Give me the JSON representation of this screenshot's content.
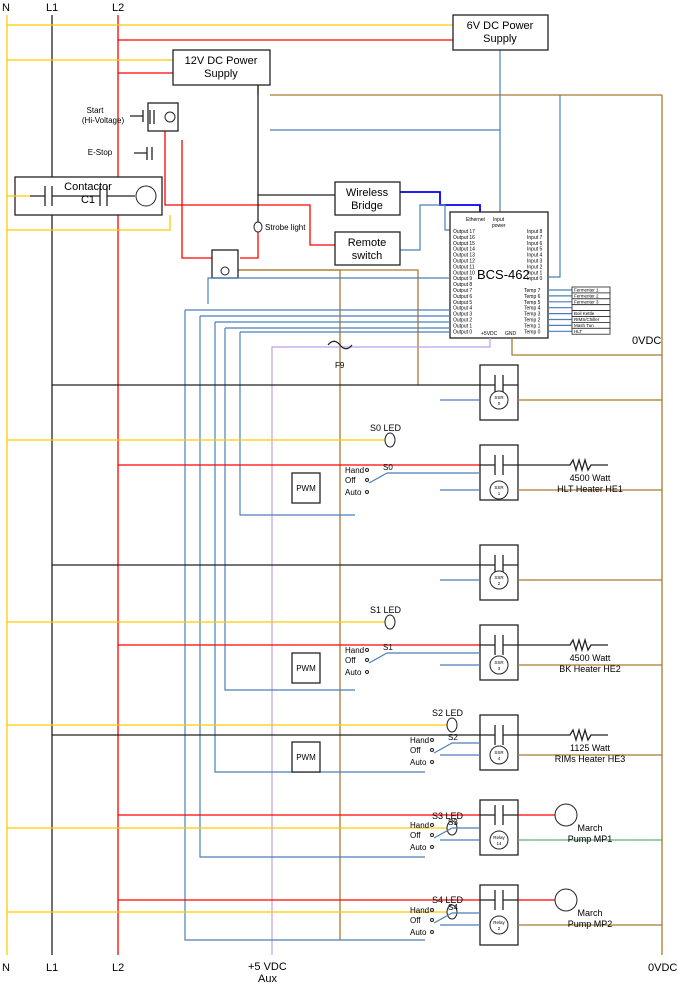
{
  "rails": {
    "neutral": "N",
    "line1": "L1",
    "line2": "L2",
    "zero_vdc": "0VDC",
    "aux": "+5 VDC",
    "aux2": "Aux"
  },
  "colors": {
    "neutral": "#ffcc00",
    "line1": "#222222",
    "line2": "#ff0000",
    "signal": "#4a7ebb",
    "dc_return": "#a87b2c",
    "aux_5v": "#b9a0ea"
  },
  "supplies": {
    "v6": [
      "6V DC Power",
      "Supply"
    ],
    "v12": [
      "12V DC Power",
      "Supply"
    ]
  },
  "controls": {
    "start": [
      "Start",
      "(Hi-Voltage)"
    ],
    "estop": "E-Stop",
    "contactor": [
      "Contactor",
      "C1"
    ],
    "strobe": "Strobe light",
    "fuse": "F9"
  },
  "network": {
    "wireless": [
      "Wireless",
      "Bridge"
    ],
    "remote": [
      "Remote",
      "switch"
    ]
  },
  "bcs": {
    "title": "BCS-462",
    "ethernet": "Ethernet",
    "input_power": [
      "Input",
      "power"
    ],
    "outputs": [
      "Output 17",
      "Output 16",
      "Output 15",
      "Output 14",
      "Output 13",
      "Output 12",
      "Output 11",
      "Output 10",
      "Output 9",
      "Output 8",
      "Output 7",
      "Output 6",
      "Output 5",
      "Output 4",
      "Output 3",
      "Output 2",
      "Output 1",
      "Output 0"
    ],
    "inputs": [
      "Input 8",
      "Input 7",
      "Input 6",
      "Input 5",
      "Input 4",
      "Input 3",
      "Input 2",
      "Input 1",
      "Input 0"
    ],
    "temps": [
      "Temp 7",
      "Temp 6",
      "Temp 5",
      "Temp 4",
      "Temp 3",
      "Temp 2",
      "Temp 1",
      "Temp 0"
    ],
    "temp_probes": [
      "Fermenter 1",
      "Fermenter 2",
      "Fermenter 3",
      "",
      "Boil Kettle",
      "RIMS/Chiller",
      "Mash Tun",
      "HLT"
    ],
    "v5": "+5VDC",
    "gnd": "GND"
  },
  "relays": [
    {
      "label": [
        "SSR",
        "0"
      ]
    },
    {
      "label": [
        "SSR",
        "1"
      ]
    },
    {
      "label": [
        "SSR",
        "2"
      ]
    },
    {
      "label": [
        "SSR",
        "3"
      ]
    },
    {
      "label": [
        "SSR",
        "4"
      ]
    },
    {
      "label": [
        "Relay",
        "14"
      ]
    },
    {
      "label": [
        "Relay",
        "2"
      ]
    }
  ],
  "leds": [
    "S0 LED",
    "S1 LED",
    "S2 LED",
    "S3 LED",
    "S4 LED"
  ],
  "switches": {
    "hand": "Hand",
    "off": "Off",
    "auto": "Auto",
    "names": [
      "S0",
      "S1",
      "S2",
      "S3",
      "S4"
    ],
    "pwm": "PWM"
  },
  "loads": [
    [
      "4500 Watt",
      "HLT Heater HE1"
    ],
    [
      "4500 Watt",
      "BK Heater HE2"
    ],
    [
      "1125 Watt",
      "RIMs Heater HE3"
    ],
    [
      "March",
      "Pump MP1"
    ],
    [
      "March",
      "Pump MP2"
    ]
  ]
}
